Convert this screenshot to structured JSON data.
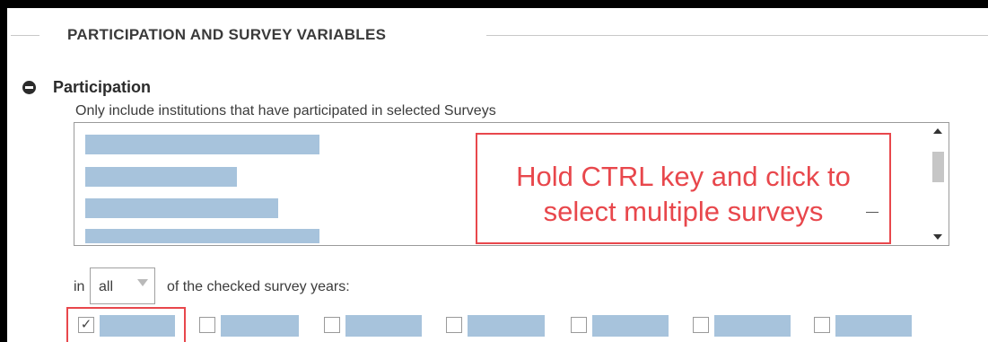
{
  "section": {
    "title": "PARTICIPATION AND SURVEY VARIABLES"
  },
  "participation": {
    "title": "Participation",
    "description": "Only include institutions that have participated in selected Surveys"
  },
  "annotation": {
    "line1": "Hold CTRL key and click to",
    "line2": "select multiple surveys"
  },
  "filter": {
    "prefix": "in",
    "selected": "all",
    "suffix": "of the checked survey years:"
  },
  "years": [
    {
      "checked": true,
      "check_glyph": "✓"
    },
    {
      "checked": false
    },
    {
      "checked": false
    },
    {
      "checked": false
    },
    {
      "checked": false
    },
    {
      "checked": false
    },
    {
      "checked": false
    }
  ],
  "colors": {
    "accent": "#e8474c",
    "redacted": "#a7c3dc"
  }
}
